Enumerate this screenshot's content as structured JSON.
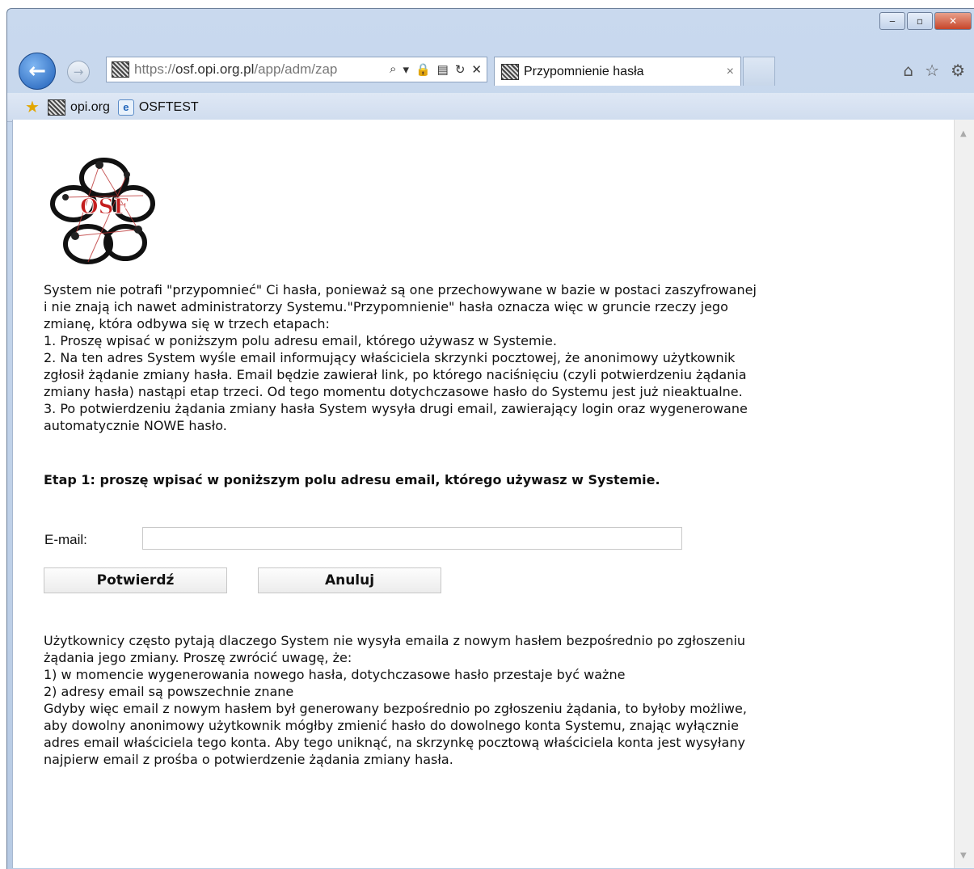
{
  "browser": {
    "address": {
      "scheme": "https://",
      "domain": "osf.opi.org.pl",
      "path": "/app/adm/zap"
    },
    "tab": {
      "title": "Przypomnienie hasła",
      "close": "×"
    },
    "favorites": [
      {
        "label": "opi.org"
      },
      {
        "label": "OSFTEST"
      }
    ],
    "window_controls": {
      "minimize": "‒",
      "maximize": "▫",
      "close": "✕"
    }
  },
  "logo": {
    "text": "OSF"
  },
  "intro": {
    "lines": [
      "System nie potrafi \"przypomnieć\" Ci hasła, ponieważ są one przechowywane w bazie w postaci zaszyfrowanej",
      "i nie znają ich nawet administratorzy Systemu.\"Przypomnienie\" hasła oznacza więc w gruncie rzeczy jego",
      "zmianę, która odbywa się w trzech etapach:",
      "1. Proszę wpisać w poniższym polu adresu email, którego używasz w Systemie.",
      "2. Na ten adres System wyśle email informujący właściciela skrzynki pocztowej, że anonimowy użytkownik",
      "zgłosił żądanie zmiany hasła. Email będzie zawierał link, po którego naciśnięciu (czyli potwierdzeniu żądania",
      "zmiany hasła) nastąpi etap trzeci. Od tego momentu dotychczasowe hasło do Systemu jest już nieaktualne.",
      "3. Po potwierdzeniu żądania zmiany hasła System wysyła drugi email, zawierający login oraz wygenerowane",
      "automatycznie NOWE hasło."
    ]
  },
  "step": {
    "title": "Etap 1: proszę wpisać w poniższym polu adresu email, którego używasz w Systemie."
  },
  "form": {
    "email_label": "E-mail:",
    "email_value": "",
    "confirm_label": "Potwierdź",
    "cancel_label": "Anuluj"
  },
  "faq": {
    "lines": [
      "Użytkownicy często pytają dlaczego System nie wysyła emaila z nowym hasłem bezpośrednio po zgłoszeniu",
      "żądania jego zmiany. Proszę zwrócić uwagę, że:",
      "1) w momencie wygenerowania nowego hasła, dotychczasowe hasło przestaje być ważne",
      "2) adresy email są powszechnie znane",
      "Gdyby więc email z nowym hasłem był generowany bezpośrednio po zgłoszeniu żądania, to byłoby możliwe,",
      "aby dowolny anonimowy użytkownik mógłby zmienić hasło do dowolnego konta Systemu, znając wyłącznie",
      "adres email właściciela tego konta. Aby tego uniknąć, na skrzynkę pocztową właściciela konta jest wysyłany",
      "najpierw email z prośba o potwierdzenie żądania zmiany hasła."
    ]
  }
}
